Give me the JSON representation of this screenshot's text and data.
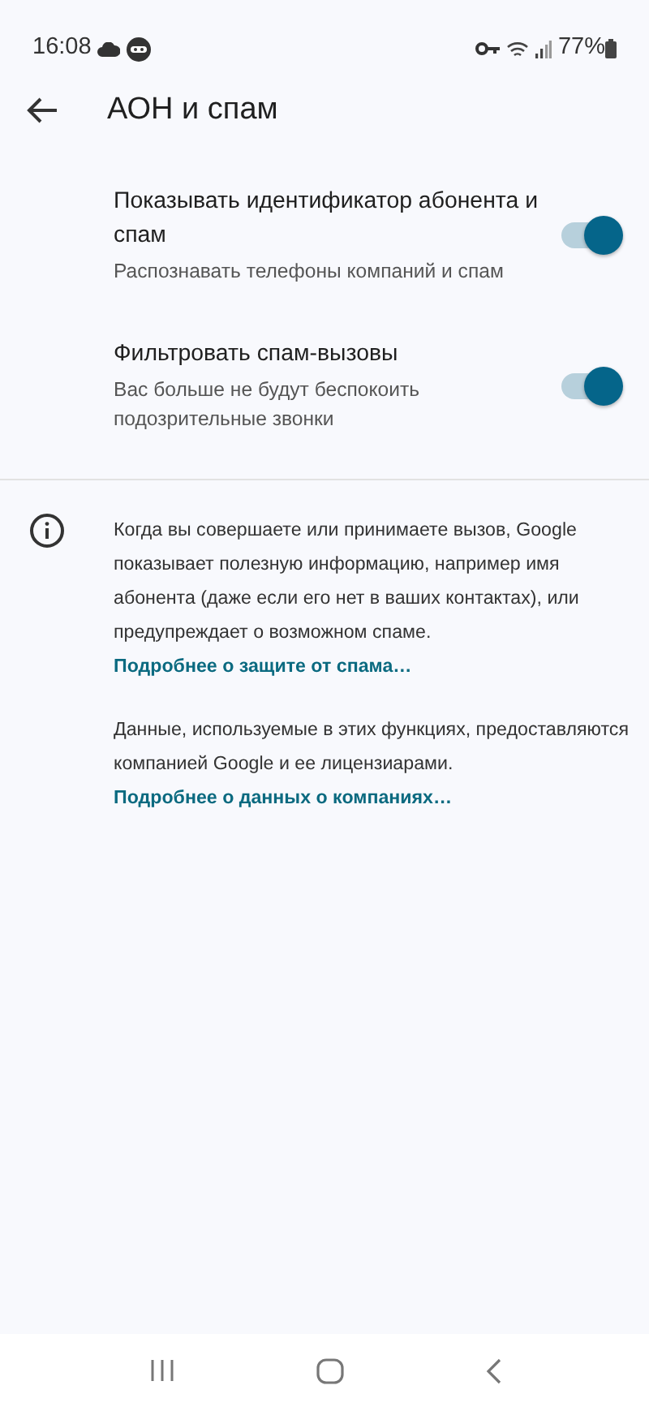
{
  "status_bar": {
    "time": "16:08",
    "battery": "77%"
  },
  "header": {
    "title": "АОН и спам"
  },
  "settings": [
    {
      "title": "Показывать идентификатор абонента и спам",
      "subtitle": "Распознавать телефоны компаний и спам",
      "on": true
    },
    {
      "title": "Фильтровать спам-вызовы",
      "subtitle": "Вас больше не будут беспокоить подозрительные звонки",
      "on": true
    }
  ],
  "info": [
    {
      "text": "Когда вы совершаете или принимаете вызов, Google показывает полезную информацию, например имя абонента (даже если его нет в ваших контактах), или предупреждает о возможном спаме.",
      "link": "Подробнее о защите от спама…"
    },
    {
      "text": "Данные, используемые в этих функциях, предоставляются компанией Google и ее лицензиарами.",
      "link": "Подробнее о данных о компаниях…"
    }
  ]
}
